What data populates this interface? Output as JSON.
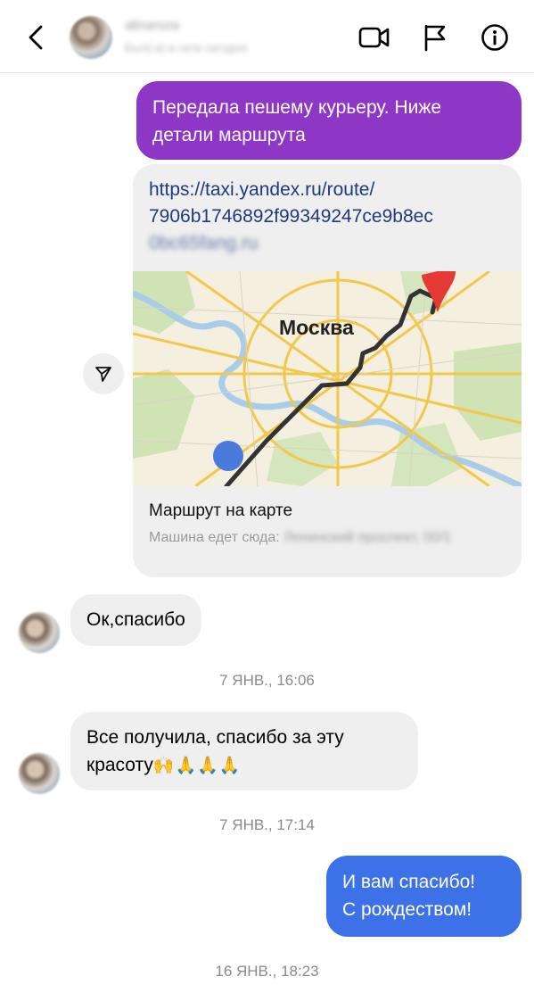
{
  "header": {
    "contact_name": "alinaroza",
    "contact_status": "Был(-а) в сети сегодня",
    "icons": [
      "chevron-left-icon",
      "video-camera-icon",
      "flag-icon",
      "info-icon"
    ]
  },
  "messages": {
    "outgoing_1": "Передала пешему курьеру. Ниже детали маршрута",
    "link_card": {
      "url_line1": "https://taxi.yandex.ru/route/",
      "url_line2": "7906b1746892f99349247ce9b8ec",
      "url_line3_blurred": "0bc65fang.ru",
      "map_city": "Москва",
      "title": "Маршрут на карте",
      "subtitle_prefix": "Машина едет сюда:",
      "subtitle_blurred": "Ленинский проспект, 00/1"
    },
    "incoming_1": "Ок,спасибо",
    "timestamp_1": "7 ЯНВ., 16:06",
    "incoming_2_line1": "Все получила, спасибо за эту",
    "incoming_2_line2": "красоту",
    "incoming_2_emoji": "🙌🙏🙏🙏",
    "timestamp_2": "7 ЯНВ., 17:14",
    "outgoing_2_line1": "И вам спасибо!",
    "outgoing_2_line2": "С рождеством!",
    "timestamp_3": "16 ЯНВ., 18:23"
  },
  "colors": {
    "outgoing_purple": "#8e36c6",
    "outgoing_blue": "#3d71e8",
    "incoming_gray": "#efefef",
    "link_blue": "#1d3a82"
  }
}
